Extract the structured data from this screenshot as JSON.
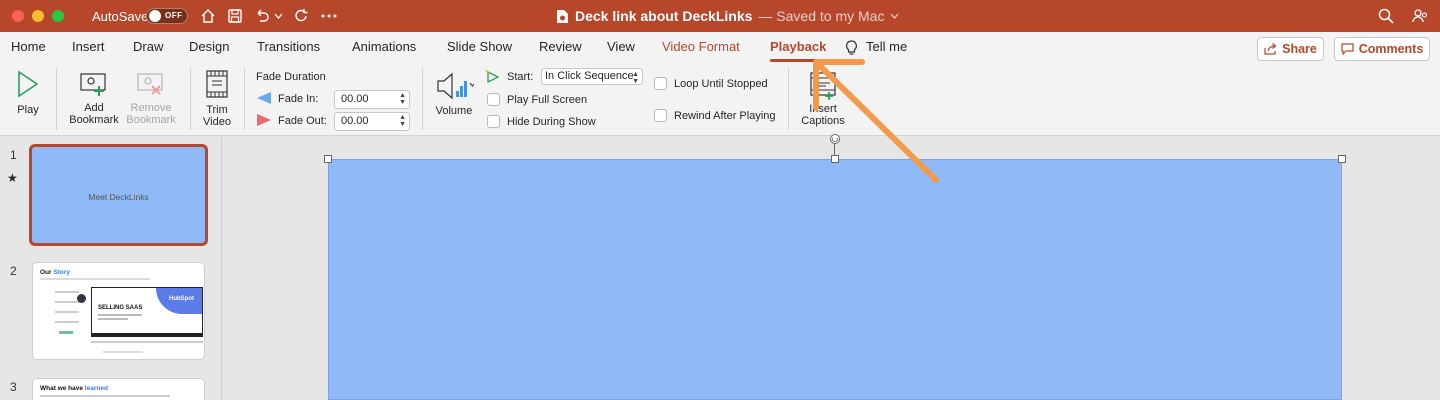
{
  "titlebar": {
    "autosave_label": "AutoSave",
    "autosave_state": "OFF",
    "doc_name": "Deck link about DeckLinks",
    "doc_status": "— Saved to my Mac"
  },
  "tabs": [
    {
      "label": "Home"
    },
    {
      "label": "Insert"
    },
    {
      "label": "Draw"
    },
    {
      "label": "Design"
    },
    {
      "label": "Transitions"
    },
    {
      "label": "Animations"
    },
    {
      "label": "Slide Show"
    },
    {
      "label": "Review"
    },
    {
      "label": "View"
    },
    {
      "label": "Video Format"
    },
    {
      "label": "Playback"
    },
    {
      "label": "Tell me"
    }
  ],
  "share_label": "Share",
  "comments_label": "Comments",
  "ribbon": {
    "play": "Play",
    "add_bookmark_1": "Add",
    "add_bookmark_2": "Bookmark",
    "remove_bookmark_1": "Remove",
    "remove_bookmark_2": "Bookmark",
    "trim_1": "Trim",
    "trim_2": "Video",
    "fade_duration": "Fade Duration",
    "fade_in_label": "Fade In:",
    "fade_in_value": "00.00",
    "fade_out_label": "Fade Out:",
    "fade_out_value": "00.00",
    "volume": "Volume",
    "start_label": "Start:",
    "start_value": "In Click Sequence",
    "play_full_screen": "Play Full Screen",
    "hide_during_show": "Hide During Show",
    "loop_until_stopped": "Loop Until Stopped",
    "rewind_after_playing": "Rewind After Playing",
    "insert_captions_1": "Insert",
    "insert_captions_2": "Captions"
  },
  "slides": [
    {
      "number": "1",
      "title": "Meet DeckLinks"
    },
    {
      "number": "2",
      "title_a": "Our ",
      "title_b": "Story",
      "sub": "SELLING SAAS",
      "brand": "HubSpot"
    },
    {
      "number": "3",
      "title_a": "What we have ",
      "title_b": "learned"
    }
  ],
  "colors": {
    "accent": "#b7472a",
    "slide_fill": "#8fb9f7",
    "annotation_arrow": "#f39a4c"
  }
}
